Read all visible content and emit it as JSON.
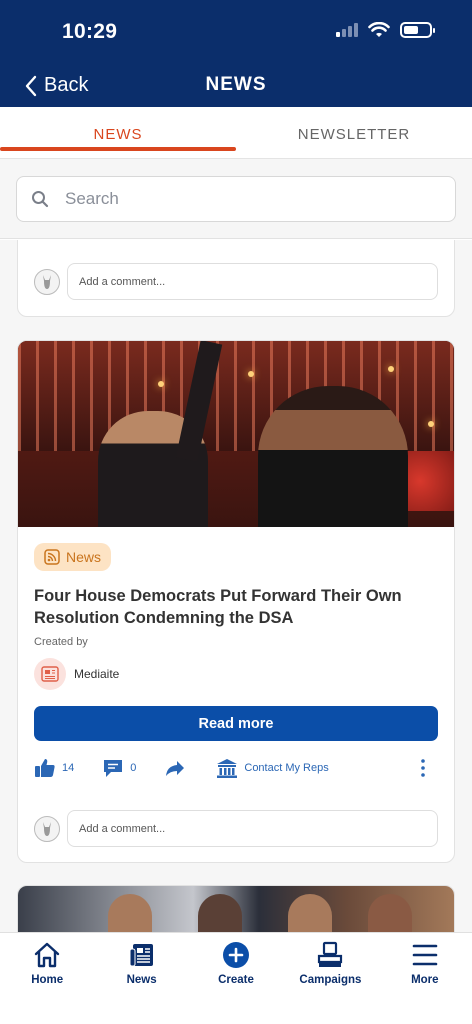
{
  "status_bar": {
    "time": "10:29"
  },
  "nav": {
    "back_label": "Back",
    "title": "NEWS"
  },
  "tabs": [
    {
      "label": "NEWS",
      "active": true
    },
    {
      "label": "NEWSLETTER",
      "active": false
    }
  ],
  "search": {
    "placeholder": "Search"
  },
  "feed": {
    "comment_placeholder": "Add a comment...",
    "article": {
      "badge": "News",
      "headline": "Four House Democrats Put Forward Their Own Resolution Condemning the DSA",
      "created_by_label": "Created by",
      "source": "Mediaite",
      "read_more": "Read more",
      "likes": "14",
      "comments": "0",
      "contact_label": "Contact My Reps"
    }
  },
  "tabbar": [
    {
      "label": "Home",
      "icon": "home-icon"
    },
    {
      "label": "News",
      "icon": "newspaper-icon"
    },
    {
      "label": "Create",
      "icon": "plus-circle-icon"
    },
    {
      "label": "Campaigns",
      "icon": "ballot-box-icon"
    },
    {
      "label": "More",
      "icon": "menu-icon"
    }
  ],
  "colors": {
    "header_bg": "#0b2e6b",
    "accent_orange": "#d9461e",
    "primary_blue": "#0b4ea8",
    "badge_bg": "#fde3c4",
    "badge_text": "#c9741d"
  }
}
